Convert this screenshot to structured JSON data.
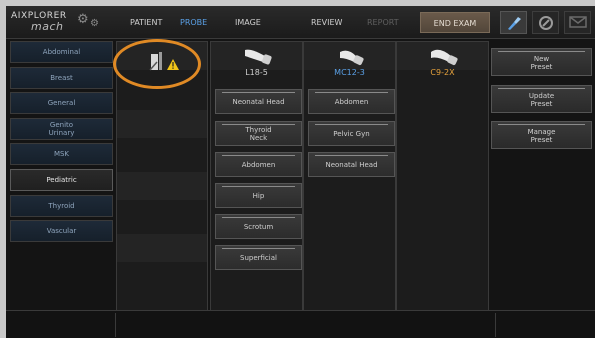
{
  "header": {
    "logo_top": "AIXPLORER",
    "logo_bottom": "mach",
    "nav": [
      "PATIENT",
      "PROBE",
      "IMAGE",
      "REVIEW",
      "REPORT"
    ],
    "active_nav": "PROBE",
    "disabled_nav": "REPORT",
    "end_exam_label": "END EXAM",
    "toolbar_icons": [
      "probe-wand-icon",
      "disk-icon",
      "envelope-icon"
    ]
  },
  "applications": {
    "items": [
      "Abdominal",
      "Breast",
      "General",
      "Genito Urinary",
      "MSK",
      "Pediatric",
      "Thyroid",
      "Vascular"
    ],
    "selected": "Pediatric"
  },
  "probes": [
    {
      "name": "",
      "icon": "probe-warning-icon",
      "label_color": "#e6c24a",
      "presets": []
    },
    {
      "name": "L18-5",
      "icon": "linear-probe-icon",
      "label_color": "#cfcfcf",
      "presets": [
        "Neonatal Head",
        "Thyroid Neck",
        "Abdomen",
        "Hip",
        "Scrotum",
        "Superficial"
      ]
    },
    {
      "name": "MC12-3",
      "icon": "microconvex-probe-icon",
      "label_color": "#5aa0e6",
      "presets": [
        "Abdomen",
        "Pelvic Gyn",
        "Neonatal Head"
      ]
    },
    {
      "name": "C9-2X",
      "icon": "convex-probe-icon",
      "label_color": "#e6a23c",
      "presets": []
    }
  ],
  "preset_actions": [
    "New Preset",
    "Update Preset",
    "Manage Preset"
  ],
  "colors": {
    "accent": "#5aa0e6",
    "highlight": "#e08a25",
    "warning": "#f0c419"
  }
}
